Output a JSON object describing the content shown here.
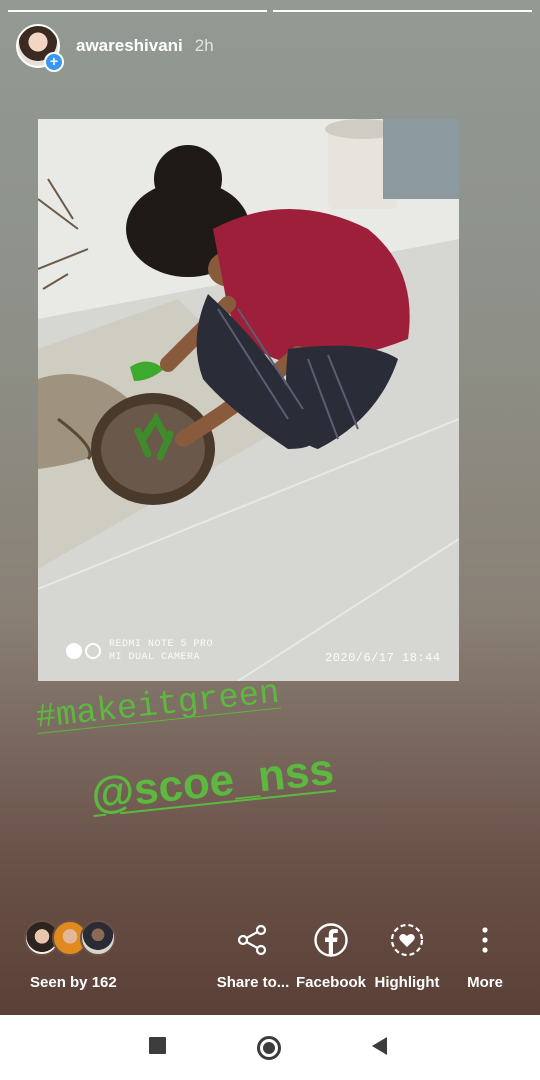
{
  "story": {
    "progress_fill_fraction": 1.0,
    "segments": 2
  },
  "header": {
    "username": "awareshivani",
    "time": "2h",
    "plus_glyph": "+"
  },
  "photo": {
    "watermark_line1": "REDMI NOTE 5 PRO",
    "watermark_line2": "MI DUAL CAMERA",
    "datetime": "2020/6/17  18:44"
  },
  "stickers": {
    "hashtag": "#makeitgreen",
    "mention": "@scoe_nss"
  },
  "footer": {
    "seen_by": "Seen by 162",
    "actions": [
      {
        "label": "Share to...",
        "icon": "share-icon"
      },
      {
        "label": "Facebook",
        "icon": "facebook-icon"
      },
      {
        "label": "Highlight",
        "icon": "highlight-heart-icon"
      },
      {
        "label": "More",
        "icon": "more-vertical-icon"
      }
    ]
  },
  "navbar": {
    "buttons": [
      "recent-apps-icon",
      "home-icon",
      "back-icon"
    ]
  },
  "colors": {
    "sticker_green": "#5cb83e",
    "instagram_blue": "#3897f0"
  }
}
